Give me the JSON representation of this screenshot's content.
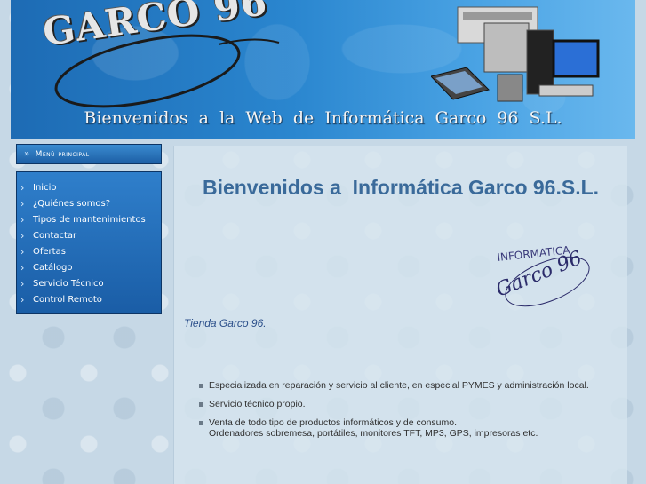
{
  "header": {
    "logo_text": "GARCO 96",
    "tagline": "Bienvenidos a la Web de Informática Garco 96 S.L."
  },
  "menu": {
    "title": "Menú principal",
    "items": [
      {
        "label": "Inicio"
      },
      {
        "label": "¿Quiénes somos?"
      },
      {
        "label": "Tipos de mantenimientos"
      },
      {
        "label": "Contactar"
      },
      {
        "label": "Ofertas"
      },
      {
        "label": "Catálogo"
      },
      {
        "label": "Servicio Técnico"
      },
      {
        "label": "Control Remoto"
      }
    ]
  },
  "main": {
    "heading": "Bienvenidos a  Informática Garco 96.S.L.",
    "brand_logo_top": "INFORMATICA",
    "brand_logo_bottom": "Garco 96",
    "tienda": "Tienda Garco 96.",
    "bullets": [
      {
        "line1": "Especializada en reparación y servicio al cliente, en especial PYMES y administración local.",
        "line2": ""
      },
      {
        "line1": "Servicio técnico propio.",
        "line2": ""
      },
      {
        "line1": "Venta de todo tipo de productos informáticos y de consumo.",
        "line2": "Ordenadores sobremesa, portátiles, monitores TFT, MP3, GPS, impresoras etc."
      }
    ]
  },
  "colors": {
    "menu_blue": "#1d5fa5",
    "heading_blue": "#3a6a9a",
    "header_blue": "#2a86cf"
  }
}
